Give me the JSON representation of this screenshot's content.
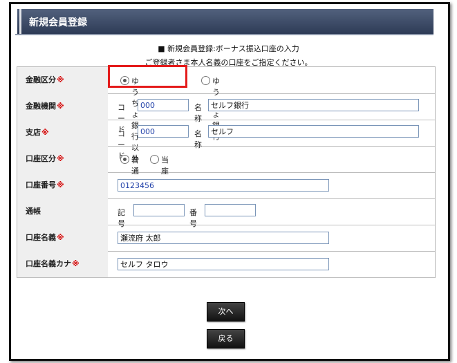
{
  "header": {
    "title": "新規会員登録"
  },
  "intro": {
    "line1": "■ 新規会員登録:ボーナス振込口座の入力",
    "line2": "ご登録者さま本人名義の口座をご指定ください。"
  },
  "rows": [
    {
      "label": "金融区分",
      "required": "※",
      "options": [
        {
          "label": "ゆうちょ銀行以外",
          "selected": true
        },
        {
          "label": "ゆうちょ銀行",
          "selected": false
        }
      ]
    },
    {
      "label": "金融機関",
      "required": "※",
      "code_label": "コード",
      "code_value": "000",
      "name_label": "名称",
      "name_value": "セルフ銀行"
    },
    {
      "label": "支店",
      "required": "※",
      "code_label": "コード",
      "code_value": "000",
      "name_label": "名称",
      "name_value": "セルフ"
    },
    {
      "label": "口座区分",
      "required": "※",
      "options": [
        {
          "label": "普通",
          "selected": true
        },
        {
          "label": "当座",
          "selected": false
        }
      ]
    },
    {
      "label": "口座番号",
      "required": "※",
      "value": "0123456"
    },
    {
      "label": "通帳",
      "required": "",
      "kigo_label": "記号",
      "kigo_value": "",
      "bango_label": "番号",
      "bango_value": ""
    },
    {
      "label": "口座名義",
      "required": "※",
      "value": "瀬流府 太郎"
    },
    {
      "label": "口座名義カナ",
      "required": "※",
      "value": "セルフ タロウ"
    }
  ],
  "buttons": {
    "next": "次へ",
    "back": "戻る"
  }
}
